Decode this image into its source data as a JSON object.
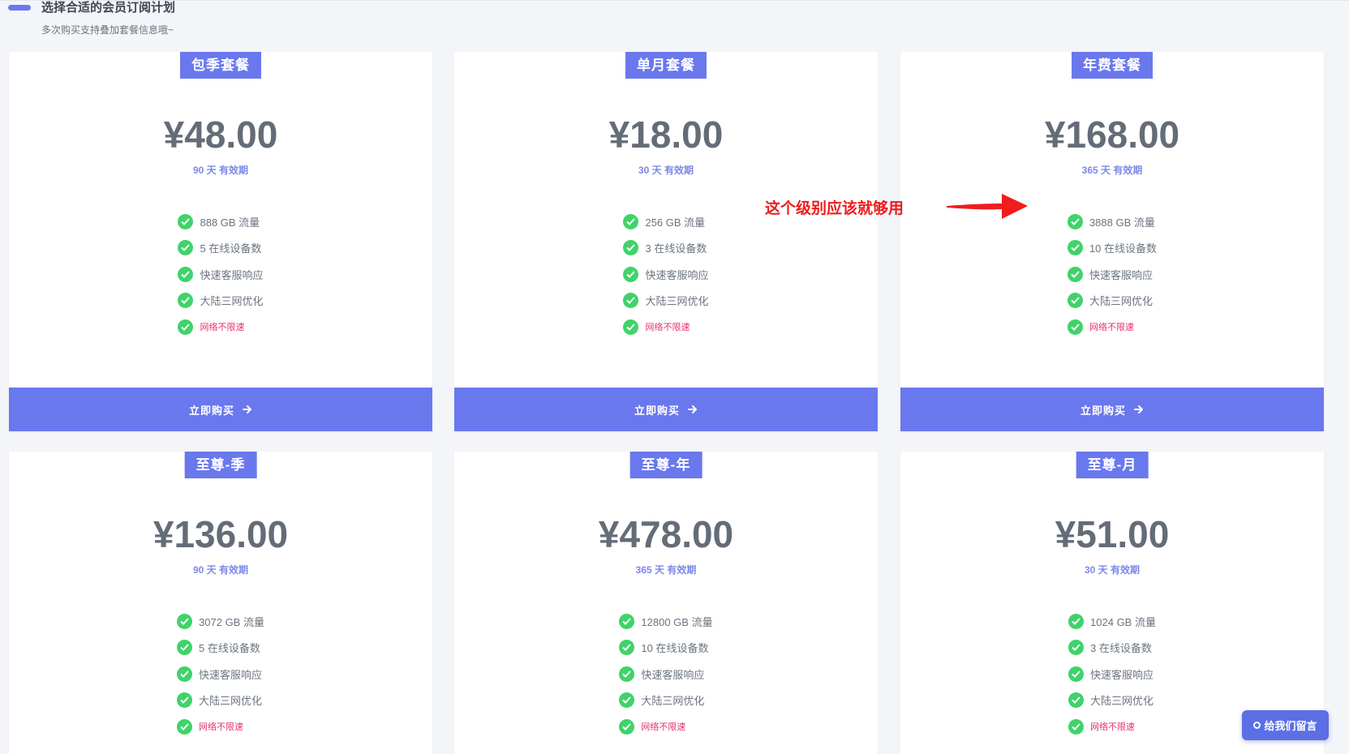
{
  "header": {
    "title": "选择合适的会员订阅计划",
    "subtitle": "多次购买支持叠加套餐信息哦~"
  },
  "plans": [
    {
      "name": "包季套餐",
      "price": "¥48.00",
      "validity": "90 天 有效期",
      "features": [
        "888 GB 流量",
        "5 在线设备数",
        "快速客服响应",
        "大陆三网优化"
      ],
      "highlight_feature": "网络不限速",
      "buy_label": "立即购买"
    },
    {
      "name": "单月套餐",
      "price": "¥18.00",
      "validity": "30 天 有效期",
      "features": [
        "256 GB 流量",
        "3 在线设备数",
        "快速客服响应",
        "大陆三网优化"
      ],
      "highlight_feature": "网络不限速",
      "buy_label": "立即购买"
    },
    {
      "name": "年费套餐",
      "price": "¥168.00",
      "validity": "365 天 有效期",
      "features": [
        "3888 GB 流量",
        "10 在线设备数",
        "快速客服响应",
        "大陆三网优化"
      ],
      "highlight_feature": "网络不限速",
      "buy_label": "立即购买"
    },
    {
      "name": "至尊-季",
      "price": "¥136.00",
      "validity": "90 天 有效期",
      "features": [
        "3072 GB 流量",
        "5 在线设备数",
        "快速客服响应",
        "大陆三网优化"
      ],
      "highlight_feature": "网络不限速"
    },
    {
      "name": "至尊-年",
      "price": "¥478.00",
      "validity": "365 天 有效期",
      "features": [
        "12800 GB 流量",
        "10 在线设备数",
        "快速客服响应",
        "大陆三网优化"
      ],
      "highlight_feature": "网络不限速"
    },
    {
      "name": "至尊-月",
      "price": "¥51.00",
      "validity": "30 天 有效期",
      "features": [
        "1024 GB 流量",
        "3 在线设备数",
        "快速客服响应",
        "大陆三网优化"
      ],
      "highlight_feature": "网络不限速"
    }
  ],
  "annotation": {
    "text": "这个级别应该就够用",
    "color": "#ef1d1d"
  },
  "feedback": {
    "label": "给我们留言"
  },
  "colors": {
    "accent": "#6a78ee",
    "check": "#3fd36a",
    "highlight_text": "#e2336b",
    "price_text": "#646c78"
  },
  "icons": {
    "feature_check": "check-circle-icon",
    "buy_arrow": "arrow-right-icon",
    "feedback": "chat-dot-icon"
  }
}
